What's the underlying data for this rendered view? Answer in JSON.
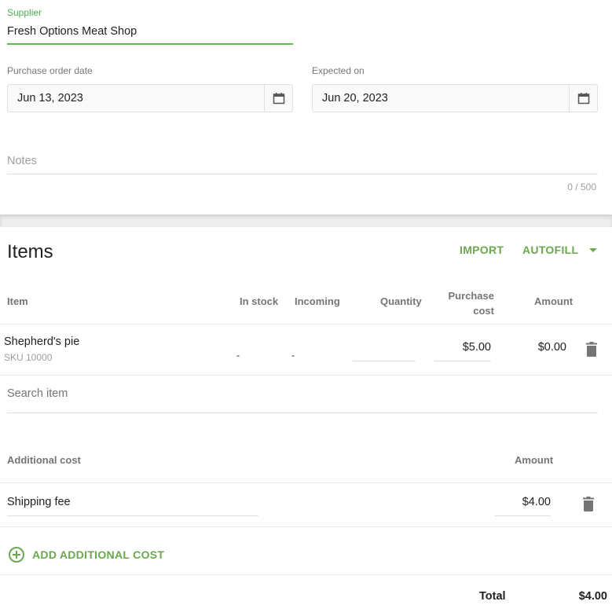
{
  "supplier": {
    "label": "Supplier",
    "value": "Fresh Options Meat Shop"
  },
  "purchase_order_date": {
    "label": "Purchase order date",
    "value": "Jun 13, 2023",
    "icon": "calendar-icon"
  },
  "expected_on": {
    "label": "Expected on",
    "value": "Jun 20, 2023",
    "icon": "calendar-icon"
  },
  "notes": {
    "placeholder": "Notes",
    "counter": "0 / 500"
  },
  "items": {
    "title": "Items",
    "import_label": "IMPORT",
    "autofill_label": "AUTOFILL",
    "columns": {
      "item": "Item",
      "in_stock": "In stock",
      "incoming": "Incoming",
      "quantity": "Quantity",
      "purchase_cost_1": "Purchase",
      "purchase_cost_2": "cost",
      "amount": "Amount"
    },
    "rows": [
      {
        "name": "Shepherd's pie",
        "sku": "SKU 10000",
        "in_stock": "-",
        "incoming": "-",
        "quantity": "",
        "purchase_cost": "$5.00",
        "amount": "$0.00"
      }
    ],
    "search_placeholder": "Search item"
  },
  "additional_cost": {
    "header_label": "Additional cost",
    "header_amount": "Amount",
    "rows": [
      {
        "name": "Shipping fee",
        "amount": "$4.00"
      }
    ],
    "add_label": "ADD ADDITIONAL COST"
  },
  "total": {
    "label": "Total",
    "value": "$4.00"
  },
  "colors": {
    "accent_green": "#6aa84f",
    "focus_green": "#5bb84a"
  }
}
